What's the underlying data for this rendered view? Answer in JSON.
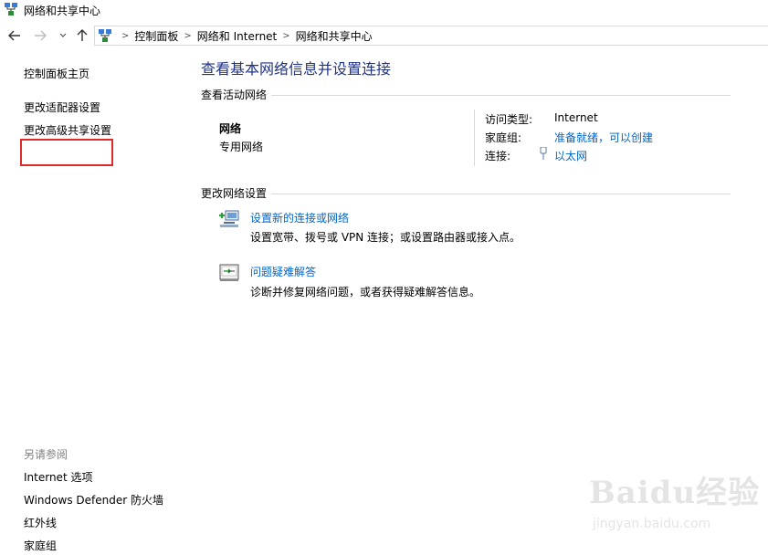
{
  "window": {
    "title": "网络和共享中心"
  },
  "address": {
    "crumbs": [
      "控制面板",
      "网络和 Internet",
      "网络和共享中心"
    ]
  },
  "sidebar": {
    "items": [
      "控制面板主页",
      "更改适配器设置",
      "更改高级共享设置"
    ],
    "see_also_title": "另请参阅",
    "see_also": [
      "Internet 选项",
      "Windows Defender 防火墙",
      "红外线",
      "家庭组"
    ]
  },
  "main": {
    "title": "查看基本网络信息并设置连接",
    "active_networks_header": "查看活动网络",
    "network": {
      "name": "网络",
      "type": "专用网络",
      "access_type_label": "访问类型:",
      "access_type_value": "Internet",
      "homegroup_label": "家庭组:",
      "homegroup_value": "准备就绪，可以创建",
      "connection_label": "连接:",
      "connection_value": "以太网"
    },
    "change_settings_header": "更改网络设置",
    "tasks": [
      {
        "link": "设置新的连接或网络",
        "desc": "设置宽带、拨号或 VPN 连接；或设置路由器或接入点。"
      },
      {
        "link": "问题疑难解答",
        "desc": "诊断并修复网络问题，或者获得疑难解答信息。"
      }
    ]
  },
  "watermark": {
    "brand": "Baidu经验",
    "url": "jingyan.baidu.com"
  },
  "colors": {
    "heading": "#1e3287",
    "link": "#0066cc",
    "highlight": "#e02a2a",
    "muted": "#808080",
    "divider": "#d9d9d9"
  }
}
